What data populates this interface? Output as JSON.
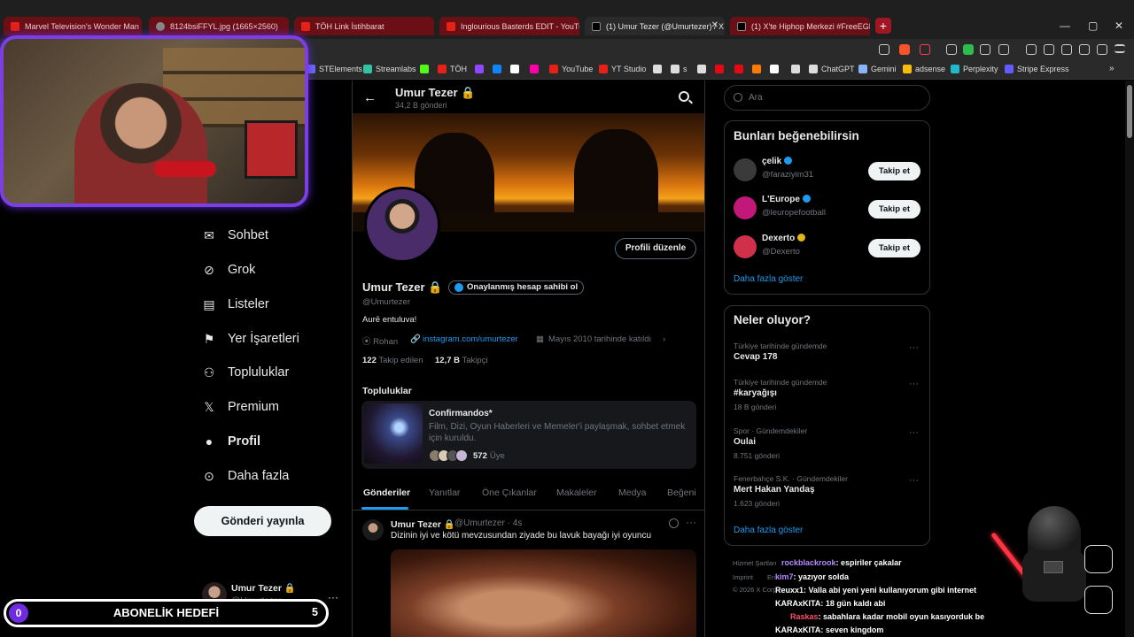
{
  "browser": {
    "tabs": [
      {
        "label": "Marvel Television's Wonder Man | Of"
      },
      {
        "label": "8124bsiFFYL.jpg (1665×2560)"
      },
      {
        "label": "TÖH Link İstihbarat"
      },
      {
        "label": "Inglourious Basterds EDIT - YouTube"
      },
      {
        "label": "(1) Umur Tezer (@Umurtezer) / X"
      },
      {
        "label": "(1) X'te Hiphop Merkezi #FreeEGE: \"N"
      }
    ],
    "new_tab": "+",
    "window_controls": [
      "—",
      "▢",
      "✕"
    ],
    "bookmarks": [
      {
        "label": "STElements",
        "color": "#6b6bff"
      },
      {
        "label": "Streamlabs",
        "color": "#31c3a2"
      },
      {
        "label": "",
        "color": "#53fc18"
      },
      {
        "label": "TÖH",
        "color": "#e62117"
      },
      {
        "label": "",
        "color": "#9146ff"
      },
      {
        "label": "",
        "color": "#1185fe"
      },
      {
        "label": "",
        "color": "#ffffff"
      },
      {
        "label": "",
        "color": "#ff00aa"
      },
      {
        "label": "YouTube",
        "color": "#e62117"
      },
      {
        "label": "YT Studio",
        "color": "#e62117"
      },
      {
        "label": "",
        "color": "#dddddd"
      },
      {
        "label": "s",
        "color": "#dddddd"
      },
      {
        "label": "",
        "color": "#dddddd"
      },
      {
        "label": "",
        "color": "#e50914"
      },
      {
        "label": "",
        "color": "#e50914"
      },
      {
        "label": "",
        "color": "#ff7a00"
      },
      {
        "label": "",
        "color": "#ffffff"
      },
      {
        "label": "",
        "color": "#dddddd"
      },
      {
        "label": "ChatGPT",
        "color": "#dddddd"
      },
      {
        "label": "Gemini",
        "color": "#8ab4f8"
      },
      {
        "label": "adsense",
        "color": "#fbbc04"
      },
      {
        "label": "Perplexity",
        "color": "#20b8cd"
      },
      {
        "label": "Stripe Express",
        "color": "#635bff"
      }
    ],
    "bookmarks_more": "»"
  },
  "nav": {
    "items": [
      {
        "label": "Sohbet",
        "icon": "envelope-icon",
        "glyph": "✉"
      },
      {
        "label": "Grok",
        "icon": "grok-icon",
        "glyph": "⊘"
      },
      {
        "label": "Listeler",
        "icon": "list-icon",
        "glyph": "▤"
      },
      {
        "label": "Yer İşaretleri",
        "icon": "bookmark-icon",
        "glyph": "⚑"
      },
      {
        "label": "Topluluklar",
        "icon": "communities-icon",
        "glyph": "⚇"
      },
      {
        "label": "Premium",
        "icon": "x-logo-icon",
        "glyph": "𝕏"
      },
      {
        "label": "Profil",
        "icon": "profile-icon",
        "glyph": "●"
      },
      {
        "label": "Daha fazla",
        "icon": "more-circle-icon",
        "glyph": "⊙"
      }
    ],
    "post_button": "Gönderi yayınla",
    "account": {
      "name": "Umur Tezer 🔒",
      "handle": "@Umurtezer",
      "more": "···"
    }
  },
  "goal": {
    "current": "0",
    "title": "ABONELİK HEDEFİ",
    "target": "5"
  },
  "profile": {
    "back": "←",
    "header_name": "Umur Tezer 🔒",
    "post_count": "34,2 B gönderi",
    "edit_button": "Profili düzenle",
    "name": "Umur Tezer 🔒",
    "verify_chip": "Onaylanmış hesap sahibi ol",
    "handle": "@Umurtezer",
    "bio": "Aurē entuluva!",
    "location": "⦿ Rohan",
    "link": "instagram.com/umurtezer",
    "joined": "Mayıs 2010 tarihinde katıldı",
    "following_count": "122",
    "following_label": "Takip edilen",
    "followers_count": "12,7 B",
    "followers_label": "Takipçi",
    "communities_title": "Topluluklar",
    "community": {
      "name": "Confirmandos*",
      "description": "Film, Dizi, Oyun Haberleri ve Memeler'i paylaşmak, sohbet etmek için kuruldu.",
      "members_count": "572",
      "members_label": "Üye"
    },
    "tabs": [
      "Gönderiler",
      "Yanıtlar",
      "Öne Çıkanlar",
      "Makaleler",
      "Medya",
      "Beğeni"
    ],
    "post": {
      "name": "Umur Tezer 🔒",
      "handle": "@Umurtezer · 4s",
      "text": "Dizinin iyi ve kötü mevzusundan ziyade bu lavuk bayağı iyi oyuncu",
      "more": "···"
    }
  },
  "right": {
    "search_placeholder": "Ara",
    "suggestions_title": "Bunları beğenebilirsin",
    "suggestions": [
      {
        "name": "çelik",
        "handle": "@faraziyim31",
        "badge": "blue",
        "avatar_color": "#3a3a3a"
      },
      {
        "name": "L'Europe",
        "handle": "@leuropefootball",
        "badge": "blue",
        "avatar_color": "#c2187a"
      },
      {
        "name": "Dexerto",
        "handle": "@Dexerto",
        "badge": "gold",
        "avatar_color": "#d1304a"
      }
    ],
    "follow_label": "Takip et",
    "show_more": "Daha fazla göster",
    "trends_title": "Neler oluyor?",
    "trends": [
      {
        "meta": "Türkiye tarihinde gündemde",
        "name": "Cevap 178",
        "count": ""
      },
      {
        "meta": "Türkiye tarihinde gündemde",
        "name": "#karyağışı",
        "count": "18 B gönderi"
      },
      {
        "meta": "Spor · Gündemdekiler",
        "name": "Oulai",
        "count": "8.751 gönderi"
      },
      {
        "meta": "Fenerbahçe S.K. · Gündemdekiler",
        "name": "Mert Hakan Yandaş",
        "count": "1.623 gönderi"
      }
    ],
    "trends_show_more": "Daha fazla göster",
    "footer": [
      "Hizmet Şartları",
      "Imprint",
      "Eri",
      "© 2026 X Corp."
    ]
  },
  "chat": [
    {
      "user": "rockblackrook",
      "msg": ": espiriler çakalar",
      "color": "purple"
    },
    {
      "user": "kim7",
      "msg": ": yazıyor solda",
      "color": "purple"
    },
    {
      "user": "Reuxx1",
      "msg": ": Valla abi yeni yeni kullanıyorum gibi internet",
      "color": "white"
    },
    {
      "user": "KARAxKITA",
      "msg": ": 18 gün kaldı abi",
      "color": "white"
    },
    {
      "user": "Raskas",
      "msg": ": sabahlara kadar mobil oyun kasıyorduk be",
      "color": "red"
    },
    {
      "user": "KARAxKITA",
      "msg": ": seven kingdom",
      "color": "white"
    }
  ]
}
